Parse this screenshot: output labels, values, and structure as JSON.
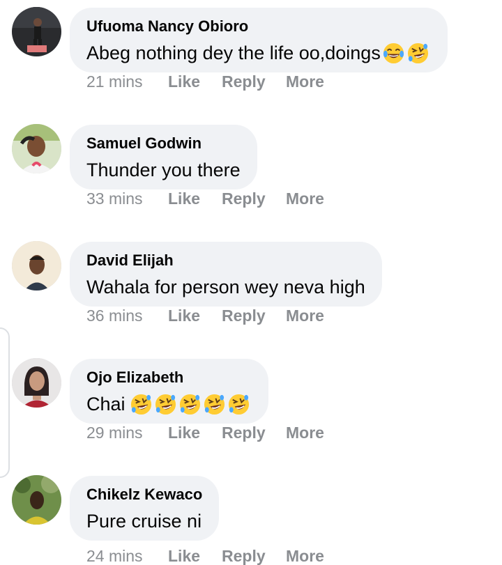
{
  "comments": [
    {
      "author": "Ufuoma Nancy Obioro",
      "text": "Abeg nothing dey the life oo,doings",
      "emojis": [
        "tears-of-joy-emoji",
        "rolling-on-floor-laughing-emoji"
      ],
      "time": "21 mins",
      "like_label": "Like",
      "reply_label": "Reply",
      "more_label": "More"
    },
    {
      "author": "Samuel Godwin",
      "text": "Thunder you there",
      "emojis": [],
      "time": "33 mins",
      "like_label": "Like",
      "reply_label": "Reply",
      "more_label": "More"
    },
    {
      "author": "David Elijah",
      "text": "Wahala for person wey neva high",
      "emojis": [],
      "time": "36 mins",
      "like_label": "Like",
      "reply_label": "Reply",
      "more_label": "More"
    },
    {
      "author": "Ojo Elizabeth",
      "text": "Chai",
      "emojis": [
        "rolling-on-floor-laughing-emoji",
        "rolling-on-floor-laughing-emoji",
        "rolling-on-floor-laughing-emoji",
        "rolling-on-floor-laughing-emoji",
        "rolling-on-floor-laughing-emoji"
      ],
      "time": "29 mins",
      "like_label": "Like",
      "reply_label": "Reply",
      "more_label": "More"
    },
    {
      "author": "Chikelz Kewaco",
      "text": "Pure cruise ni",
      "emojis": [],
      "time": "24 mins",
      "like_label": "Like",
      "reply_label": "Reply",
      "more_label": "More"
    }
  ],
  "colors": {
    "bubble_bg": "#f0f2f5",
    "author_text": "#050505",
    "action_text": "#8a8d91",
    "emoji_face": "#ffcc33",
    "emoji_tear": "#4aa8ff"
  }
}
